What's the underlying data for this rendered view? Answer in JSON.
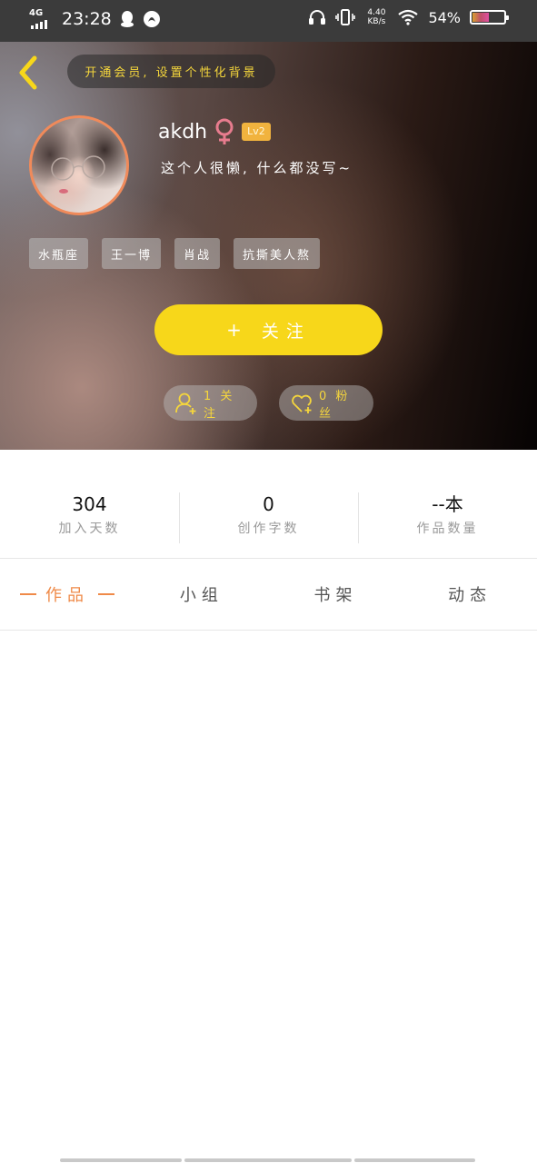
{
  "status_bar": {
    "network": "4G",
    "time": "23:28",
    "speed_top": "4.40",
    "speed_bottom": "KB/s",
    "battery": "54%",
    "battery_level": 0.54,
    "icons": [
      "signal-icon",
      "qq-icon",
      "app-notification-icon",
      "headphones-icon",
      "vibrate-icon",
      "wifi-icon",
      "battery-icon"
    ]
  },
  "header": {
    "vip_banner": "开通会员, 设置个性化背景",
    "username": "akdh",
    "gender": "female",
    "level": "Lv2",
    "signature": "这个人很懒, 什么都没写~",
    "tags": [
      "水瓶座",
      "王一博",
      "肖战",
      "抗撕美人熬"
    ],
    "follow_button": "关注",
    "follow_plus": "+",
    "following_label": "1 关注",
    "fans_label": "0 粉丝",
    "accent_color": "#f7d71a"
  },
  "stats": [
    {
      "value": "304",
      "label": "加入天数"
    },
    {
      "value": "0",
      "label": "创作字数"
    },
    {
      "value": "--本",
      "label": "作品数量"
    }
  ],
  "tabs": [
    {
      "label": "作品",
      "active": true
    },
    {
      "label": "小组",
      "active": false
    },
    {
      "label": "书架",
      "active": false
    },
    {
      "label": "动态",
      "active": false
    }
  ],
  "active_tab_color": "#ef8a48"
}
